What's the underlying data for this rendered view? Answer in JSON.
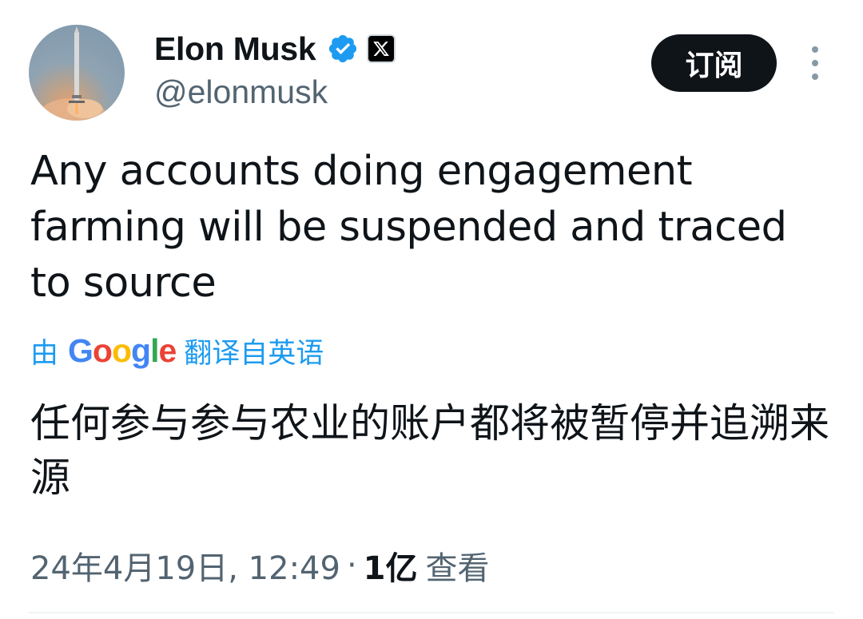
{
  "author": {
    "display_name": "Elon Musk",
    "handle": "@elonmusk",
    "verified_icon": "verified-badge-icon",
    "affiliation_icon": "x-logo-icon"
  },
  "header": {
    "subscribe_label": "订阅",
    "more_icon": "more-options-icon"
  },
  "tweet": {
    "text": "Any accounts doing engagement farming will be suspended and traced to source",
    "translate_by": "由",
    "translate_provider": "Google",
    "translate_from": "翻译自英语",
    "translation": "任何参与参与农业的账户都将被暂停并追溯来源"
  },
  "meta": {
    "timestamp": "24年4月19日, 12:49",
    "separator": "·",
    "views_count": "1亿",
    "views_label": "查看"
  },
  "colors": {
    "accent": "#1d9bf0",
    "text_primary": "#0f1419",
    "text_secondary": "#536471",
    "button_bg": "#0f1419"
  }
}
